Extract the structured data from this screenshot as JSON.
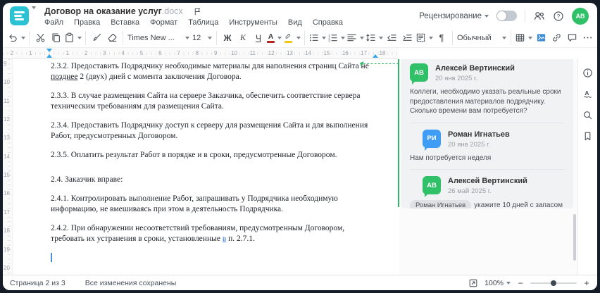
{
  "header": {
    "title": "Договор на оказание услуг",
    "title_ext": ".docx",
    "menu": [
      "Файл",
      "Правка",
      "Вставка",
      "Формат",
      "Таблица",
      "Инструменты",
      "Вид",
      "Справка"
    ],
    "review_label": "Рецензирование",
    "avatar_initials": "АВ"
  },
  "toolbar": {
    "groups": [
      {
        "items": [
          {
            "type": "icon",
            "name": "undo",
            "caret": true
          }
        ]
      },
      {
        "items": [
          {
            "type": "icon",
            "name": "cut"
          },
          {
            "type": "icon",
            "name": "copy"
          },
          {
            "type": "icon",
            "name": "paste",
            "caret": true
          }
        ]
      },
      {
        "items": [
          {
            "type": "icon",
            "name": "format-painter"
          },
          {
            "type": "icon",
            "name": "eraser"
          }
        ]
      },
      {
        "items": [
          {
            "type": "combo",
            "name": "font-name",
            "text": "Times New ...",
            "w": 78,
            "caret": true
          },
          {
            "type": "combo",
            "name": "font-size",
            "text": "12",
            "w": 18,
            "caret": true
          }
        ]
      },
      {
        "items": [
          {
            "type": "label",
            "name": "bold",
            "text": "Ж",
            "style": "b"
          },
          {
            "type": "label",
            "name": "italic",
            "text": "К",
            "style": "i"
          },
          {
            "type": "label",
            "name": "underline",
            "text": "Ч",
            "style": "u"
          },
          {
            "type": "icon",
            "name": "font-color",
            "caret": true
          },
          {
            "type": "icon",
            "name": "highlight",
            "caret": true
          }
        ]
      },
      {
        "items": [
          {
            "type": "icon",
            "name": "bullet-list",
            "caret": true
          },
          {
            "type": "icon",
            "name": "numbered-list",
            "caret": true
          },
          {
            "type": "icon",
            "name": "align",
            "caret": true
          },
          {
            "type": "icon",
            "name": "line-spacing",
            "caret": true
          },
          {
            "type": "icon",
            "name": "outdent"
          },
          {
            "type": "icon",
            "name": "indent"
          },
          {
            "type": "icon",
            "name": "paragraph-settings",
            "caret": true
          },
          {
            "type": "icon",
            "name": "pilcrow"
          }
        ]
      },
      {
        "items": [
          {
            "type": "combo",
            "name": "paragraph-style",
            "text": "Обычный",
            "w": 60,
            "caret": true
          }
        ]
      },
      {
        "items": [
          {
            "type": "icon",
            "name": "table",
            "caret": true
          },
          {
            "type": "icon",
            "name": "insert-image"
          },
          {
            "type": "icon",
            "name": "link"
          },
          {
            "type": "icon",
            "name": "insert-comment"
          },
          {
            "type": "icon",
            "name": "more"
          }
        ]
      }
    ]
  },
  "ruler": {
    "pre_numbers": [
      "1",
      "2"
    ],
    "h_numbers": [
      "1",
      "2",
      "3",
      "4",
      "5",
      "6",
      "7",
      "8",
      "9",
      "10",
      "11",
      "12",
      "13",
      "14",
      "15",
      "16",
      "17",
      "18"
    ],
    "v_numbers": [
      "9",
      "10",
      "11",
      "12",
      "13",
      "14",
      "15",
      "16",
      "17",
      "18",
      "19",
      "20"
    ]
  },
  "document": {
    "paragraphs": [
      {
        "runs": [
          {
            "text": "2.3.2. Предоставить Подрядчику необходимые материалы для наполнения страниц Сайта не "
          },
          {
            "text": "позднее",
            "style": "u"
          },
          {
            "text": " 2 (двух) дней с момента заключения Договора."
          }
        ]
      },
      {
        "runs": [
          {
            "text": "2.3.3. В случае размещения Сайта на сервере Заказчика, обеспечить соответствие сервера техническим требованиям для размещения Сайта."
          }
        ]
      },
      {
        "runs": [
          {
            "text": "2.3.4. Предоставить Подрядчику доступ к серверу для размещения Сайта и для выполнения Работ, предусмотренных Договором."
          }
        ]
      },
      {
        "runs": [
          {
            "text": "2.3.5. Оплатить результат Работ в порядке и в сроки, предусмотренные Договором."
          }
        ]
      },
      {
        "spacer": true
      },
      {
        "runs": [
          {
            "text": "2.4. Заказчик вправе:"
          }
        ]
      },
      {
        "runs": [
          {
            "text": "2.4.1. Контролировать выполнение Работ, запрашивать у Подрядчика необходимую информацию, не вмешиваясь при этом в деятельность Подрядчика."
          }
        ]
      },
      {
        "runs": [
          {
            "text": "2.4.2. При обнаружении несоответствий требованиям, предусмотренным Договором, требовать их устранения в сроки, установленные "
          },
          {
            "text": "в",
            "style": "change"
          },
          {
            "text": " п. 2.7.1."
          }
        ]
      },
      {
        "cursor": true
      }
    ]
  },
  "comments": {
    "thread": [
      {
        "initials": "АВ",
        "color": "green",
        "name": "Алексей Вертинский",
        "date": "20 янв 2025 г.",
        "text": "Коллеги, необходимо указать реальные сроки предоставления материалов подрядчику. Сколько времени вам потребуется?",
        "reply": false
      },
      {
        "initials": "РИ",
        "color": "blue",
        "name": "Роман Игнатьев",
        "date": "20 янв 2025 г.",
        "text": "Нам потребуется неделя",
        "reply": true
      },
      {
        "initials": "АВ",
        "color": "green",
        "name": "Алексей Вертинский",
        "date": "26 май 2025 г.",
        "mention": "Роман Игнатьев",
        "text": "укажите 10 дней с запасом",
        "reply": true
      }
    ]
  },
  "side_icons": [
    "info",
    "spellcheck",
    "search",
    "bookmark"
  ],
  "status": {
    "page_info": "Страница 2 из 3",
    "save_status": "Все изменения сохранены",
    "zoom_value": "100%"
  }
}
